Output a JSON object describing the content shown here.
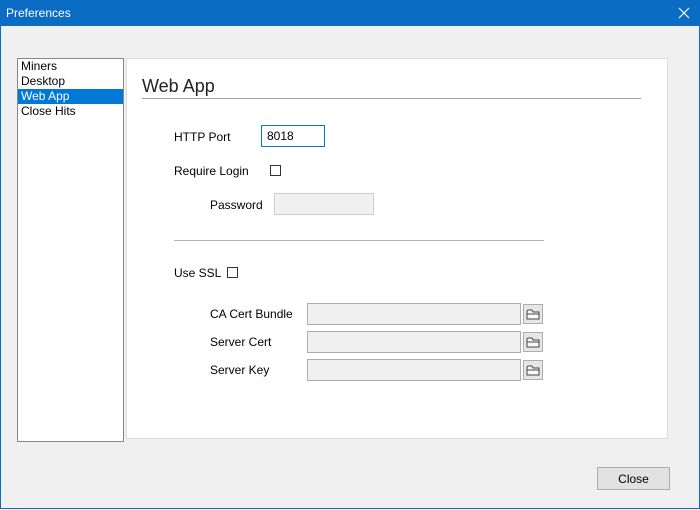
{
  "window": {
    "title": "Preferences",
    "close_icon": "close-icon"
  },
  "sidebar": {
    "items": [
      {
        "label": "Miners"
      },
      {
        "label": "Desktop"
      },
      {
        "label": "Web App",
        "selected": true
      },
      {
        "label": "Close Hits"
      }
    ]
  },
  "web_app": {
    "title": "Web App",
    "http_port_label": "HTTP Port",
    "http_port_value": "8018",
    "require_login_label": "Require Login",
    "require_login_checked": false,
    "password_label": "Password",
    "password_value": "",
    "use_ssl_label": "Use SSL",
    "use_ssl_checked": false,
    "ca_cert_label": "CA Cert Bundle",
    "server_cert_label": "Server Cert",
    "server_key_label": "Server Key"
  },
  "footer": {
    "close_label": "Close"
  },
  "colors": {
    "accent": "#0078d7",
    "titlebar": "#0b6cc3"
  }
}
